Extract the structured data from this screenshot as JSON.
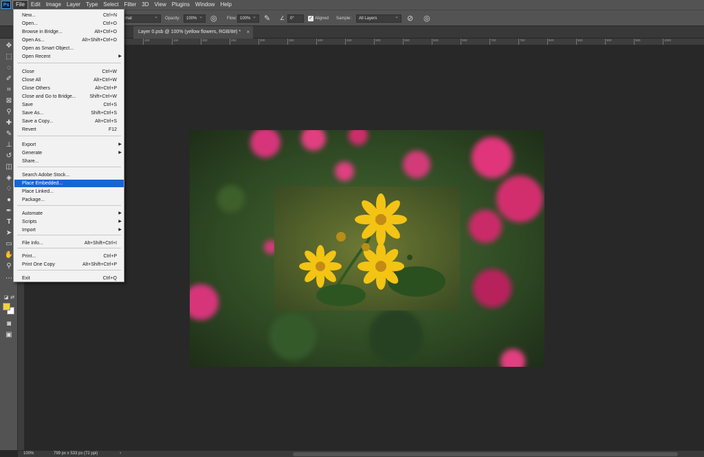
{
  "menubar": {
    "logo": "Ps",
    "items": [
      "File",
      "Edit",
      "Image",
      "Layer",
      "Type",
      "Select",
      "Filter",
      "3D",
      "View",
      "Plugins",
      "Window",
      "Help"
    ]
  },
  "options": {
    "mode_value": "mal",
    "opacity_label": "Opacity:",
    "opacity_value": "100%",
    "flow_label": "Flow:",
    "flow_value": "100%",
    "angle_value": "0°",
    "aligned_label": "Aligned",
    "sample_label": "Sample:",
    "sample_value": "All Layers"
  },
  "tab": {
    "title": "Layer 0.psb @ 100% (yellow flowers, RGB/8#) *",
    "close": "×"
  },
  "ruler_ticks": [
    "100",
    "50",
    "0",
    "50",
    "100",
    "150",
    "200",
    "250",
    "300",
    "350",
    "400",
    "450",
    "500",
    "550",
    "600",
    "650",
    "700",
    "750",
    "800",
    "850",
    "900",
    "950",
    "1000"
  ],
  "file_menu": {
    "items": [
      {
        "label": "New...",
        "shortcut": "Ctrl+N"
      },
      {
        "label": "Open...",
        "shortcut": "Ctrl+O"
      },
      {
        "label": "Browse in Bridge...",
        "shortcut": "Alt+Ctrl+O"
      },
      {
        "label": "Open As...",
        "shortcut": "Alt+Shift+Ctrl+O"
      },
      {
        "label": "Open as Smart Object...",
        "shortcut": ""
      },
      {
        "label": "Open Recent",
        "shortcut": "",
        "submenu": true
      },
      {
        "label": "Close",
        "shortcut": "Ctrl+W"
      },
      {
        "label": "Close All",
        "shortcut": "Alt+Ctrl+W"
      },
      {
        "label": "Close Others",
        "shortcut": "Alt+Ctrl+P"
      },
      {
        "label": "Close and Go to Bridge...",
        "shortcut": "Shift+Ctrl+W"
      },
      {
        "label": "Save",
        "shortcut": "Ctrl+S"
      },
      {
        "label": "Save As...",
        "shortcut": "Shift+Ctrl+S"
      },
      {
        "label": "Save a Copy...",
        "shortcut": "Alt+Ctrl+S"
      },
      {
        "label": "Revert",
        "shortcut": "F12"
      },
      {
        "label": "Export",
        "shortcut": "",
        "submenu": true
      },
      {
        "label": "Generate",
        "shortcut": "",
        "submenu": true
      },
      {
        "label": "Share...",
        "shortcut": ""
      },
      {
        "label": "Search Adobe Stock...",
        "shortcut": ""
      },
      {
        "label": "Place Embedded...",
        "shortcut": "",
        "highlighted": true
      },
      {
        "label": "Place Linked...",
        "shortcut": ""
      },
      {
        "label": "Package...",
        "shortcut": ""
      },
      {
        "label": "Automate",
        "shortcut": "",
        "submenu": true
      },
      {
        "label": "Scripts",
        "shortcut": "",
        "submenu": true
      },
      {
        "label": "Import",
        "shortcut": "",
        "submenu": true
      },
      {
        "label": "File Info...",
        "shortcut": "Alt+Shift+Ctrl+I"
      },
      {
        "label": "Print...",
        "shortcut": "Ctrl+P"
      },
      {
        "label": "Print One Copy",
        "shortcut": "Alt+Shift+Ctrl+P"
      },
      {
        "label": "Exit",
        "shortcut": "Ctrl+Q"
      }
    ]
  },
  "status": {
    "zoom": "100%",
    "doc_info": "799 px x 533 px (72 ppi)",
    "arrow": "›"
  },
  "colors": {
    "accent": "#1666d2",
    "foreground_swatch": "#f5d23c",
    "background_swatch": "#ffffff"
  }
}
